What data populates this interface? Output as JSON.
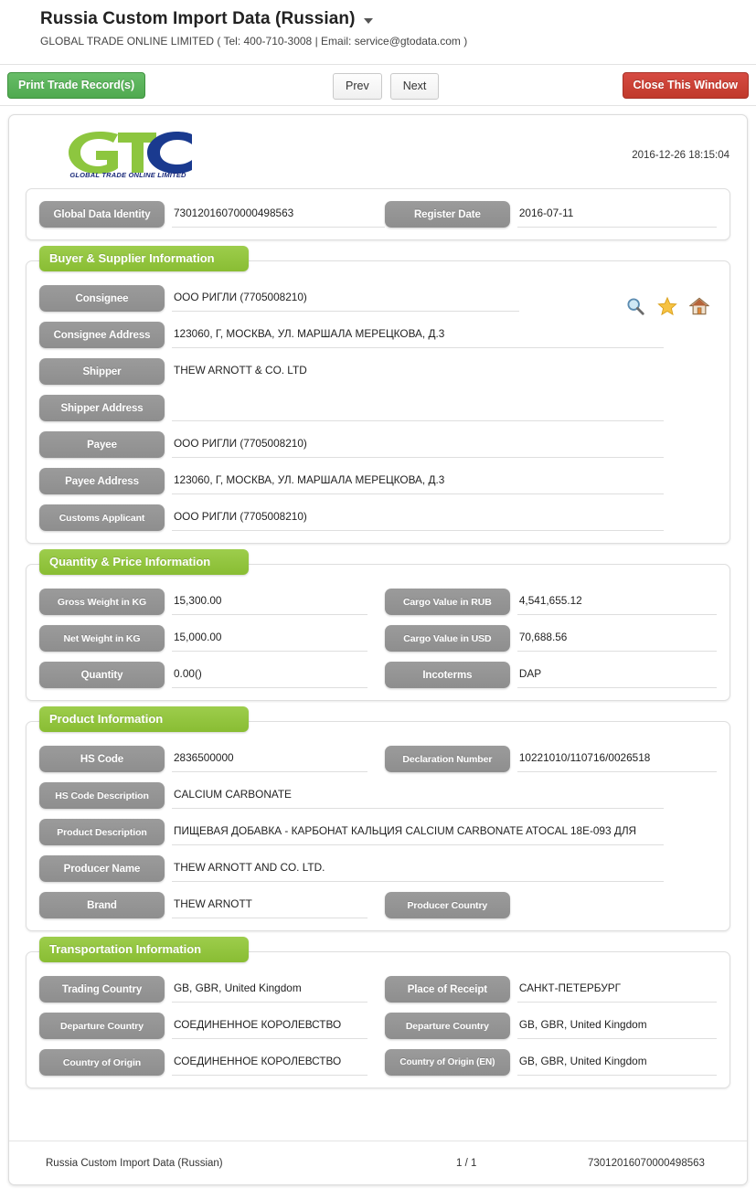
{
  "header": {
    "title": "Russia Custom Import Data (Russian)",
    "dropdown_icon": "caret-down-icon",
    "company_line": "GLOBAL TRADE ONLINE LIMITED ( Tel: 400-710-3008 | Email: service@gtodata.com )"
  },
  "toolbar": {
    "print_label": "Print Trade Record(s)",
    "prev_label": "Prev",
    "next_label": "Next",
    "close_label": "Close This Window",
    "print_color": "#4fa94f",
    "close_color": "#c0392b"
  },
  "document": {
    "logo_text": "GTO",
    "logo_subtitle": "GLOBAL TRADE  ONLINE LIMITED",
    "timestamp": "2016-12-26 18:15:04",
    "identity": {
      "label_id": "Global Data Identity",
      "value_id": "73012016070000498563",
      "label_date": "Register Date",
      "value_date": "2016-07-11"
    },
    "sections": [
      {
        "title": "Buyer & Supplier Information",
        "icons": [
          "search-icon",
          "star-icon",
          "home-icon"
        ],
        "rows": [
          {
            "label": "Consignee",
            "value": "ООО РИГЛИ (7705008210)"
          },
          {
            "label": "Consignee Address",
            "value": "123060, Г, МОСКВА, УЛ. МАРШАЛА МЕРЕЦКОВА, Д.3"
          },
          {
            "label": "Shipper",
            "value": "THEW ARNOTT & CO. LTD"
          },
          {
            "label": "Shipper Address",
            "value": ""
          },
          {
            "label": "Payee",
            "value": "ООО РИГЛИ  (7705008210)"
          },
          {
            "label": "Payee Address",
            "value": "123060, Г, МОСКВА, УЛ. МАРШАЛА МЕРЕЦКОВА, Д.3"
          },
          {
            "label": "Customs Applicant",
            "value": "ООО РИГЛИ  (7705008210)"
          }
        ]
      },
      {
        "title": "Quantity & Price Information",
        "pairs": [
          {
            "l_label": "Gross Weight in KG",
            "l_value": "15,300.00",
            "r_label": "Cargo Value in RUB",
            "r_value": "4,541,655.12"
          },
          {
            "l_label": "Net Weight in KG",
            "l_value": "15,000.00",
            "r_label": "Cargo Value in USD",
            "r_value": "70,688.56"
          },
          {
            "l_label": "Quantity",
            "l_value": "0.00()",
            "r_label": "Incoterms",
            "r_value": "DAP"
          }
        ]
      },
      {
        "title": "Product Information",
        "pairs": [
          {
            "l_label": "HS Code",
            "l_value": "2836500000",
            "r_label": "Declaration Number",
            "r_value": "10221010/110716/0026518"
          }
        ],
        "rows": [
          {
            "label": "HS Code Description",
            "value": "CALCIUM CARBONATE"
          },
          {
            "label": "Product Description",
            "value": "ПИЩЕВАЯ ДОБАВКА - КАРБОНАТ КАЛЬЦИЯ CALCIUM CARBONATE ATOCAL 18E-093 ДЛЯ"
          },
          {
            "label": "Producer Name",
            "value": "THEW ARNOTT AND CO. LTD."
          }
        ],
        "last_pair": {
          "l_label": "Brand",
          "l_value": "THEW ARNOTT",
          "r_label": "Producer Country",
          "r_value": ""
        }
      },
      {
        "title": "Transportation Information",
        "pairs": [
          {
            "l_label": "Trading Country",
            "l_value": "GB, GBR, United Kingdom",
            "r_label": "Place of Receipt",
            "r_value": "САНКТ-ПЕТЕРБУРГ"
          },
          {
            "l_label": "Departure Country",
            "l_value": "СОЕДИНЕННОЕ КОРОЛЕВСТВО",
            "r_label": "Departure Country",
            "r_value": "GB, GBR, United Kingdom"
          },
          {
            "l_label": "Country of Origin",
            "l_value": "СОЕДИНЕННОЕ КОРОЛЕВСТВО",
            "r_label": "Country of Origin (EN)",
            "r_value": "GB, GBR, United Kingdom"
          }
        ]
      }
    ],
    "footer": {
      "left": "Russia Custom Import Data (Russian)",
      "middle": "1 / 1",
      "right": "73012016070000498563"
    }
  },
  "colors": {
    "section_green": "#8dc63f",
    "pill_gray": "#919191"
  }
}
